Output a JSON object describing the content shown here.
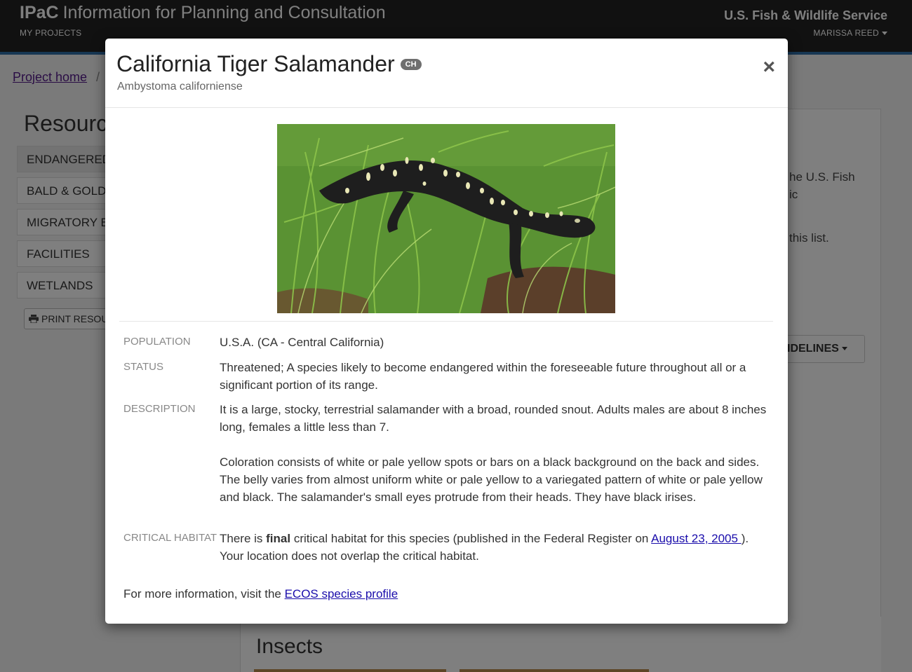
{
  "header": {
    "brand_short": "IPaC",
    "brand_long": "Information for Planning and Consultation",
    "my_projects": "MY PROJECTS",
    "agency": "U.S. Fish & Wildlife Service",
    "user": "MARISSA REED"
  },
  "page": {
    "breadcrumb_home": "Project home",
    "breadcrumb_sep": "/",
    "resources_title": "Resourc",
    "nav_items": [
      "ENDANGERED",
      "BALD & GOLD",
      "MIGRATORY B",
      "FACILITIES",
      "WETLANDS"
    ],
    "print_label": "PRINT RESOU",
    "content_fragments": [
      "he U.S. Fish",
      "ic",
      "this list."
    ],
    "guidelines_label": "IDELINES",
    "insects_heading": "Insects"
  },
  "modal": {
    "title": "California Tiger Salamander",
    "badge": "CH",
    "scientific_name": "Ambystoma californiense",
    "close_symbol": "×",
    "population_label": "POPULATION",
    "population_value": "U.S.A. (CA - Central California)",
    "status_label": "STATUS",
    "status_value": "Threatened; A species likely to become endangered within the foreseeable future throughout all or a significant portion of its range.",
    "description_label": "DESCRIPTION",
    "description_p1": "It is a large, stocky, terrestrial salamander with a broad, rounded snout. Adults males are about 8 inches long, females a little less than 7.",
    "description_p2": "Coloration consists of white or pale yellow spots or bars on a black background on the back and sides. The belly varies from almost uniform white or pale yellow to a variegated pattern of white or pale yellow and black. The salamander's small eyes protrude from their heads. They have black irises.",
    "habitat_label": "CRITICAL HABITAT",
    "habitat_pre": "There is ",
    "habitat_bold": "final",
    "habitat_mid": " critical habitat for this species (published in the Federal Register on ",
    "habitat_link": "August 23, 2005 ",
    "habitat_post": "). Your location does not overlap the critical habitat.",
    "footer_pre": "For more information, visit the ",
    "footer_link": "ECOS species profile"
  }
}
